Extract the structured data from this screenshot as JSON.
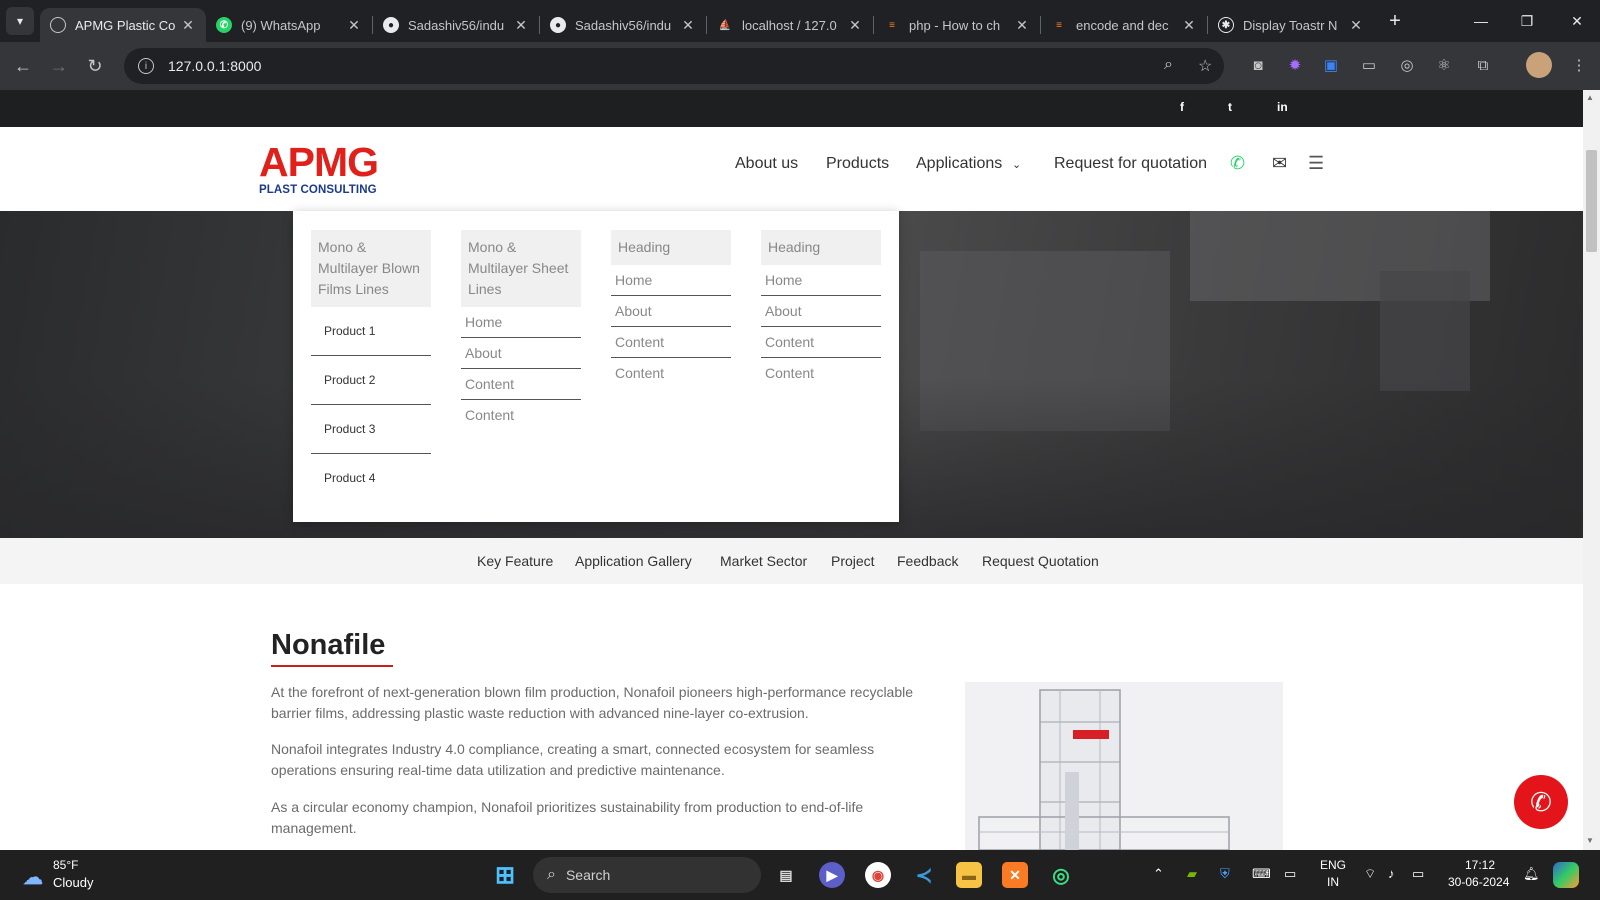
{
  "browser": {
    "tabs": [
      {
        "title": "APMG Plastic Co",
        "active": true,
        "favicon": "globe-icon"
      },
      {
        "title": "(9) WhatsApp",
        "active": false,
        "favicon": "whatsapp-icon"
      },
      {
        "title": "Sadashiv56/indu",
        "active": false,
        "favicon": "github-icon"
      },
      {
        "title": "Sadashiv56/indu",
        "active": false,
        "favicon": "github-icon"
      },
      {
        "title": "localhost / 127.0",
        "active": false,
        "favicon": "phpmyadmin-icon"
      },
      {
        "title": "php - How to ch",
        "active": false,
        "favicon": "stackoverflow-icon"
      },
      {
        "title": "encode and dec",
        "active": false,
        "favicon": "stackoverflow-icon"
      },
      {
        "title": "Display Toastr N",
        "active": false,
        "favicon": "chatgpt-icon"
      }
    ],
    "address": "127.0.0.1:8000"
  },
  "site": {
    "social": [
      "f",
      "t",
      "in"
    ],
    "logo": {
      "main": "APMG",
      "sub": "PLAST CONSULTING"
    },
    "nav": {
      "about": "About us",
      "products": "Products",
      "applications": "Applications",
      "request": "Request for quotation"
    },
    "mega_menu": {
      "col1": {
        "heading": "Mono & Multilayer Blown Films Lines",
        "links": [
          "Product 1",
          "Product 2",
          "Product 3",
          "Product 4"
        ]
      },
      "col2": {
        "heading": "Mono & Multilayer Sheet Lines",
        "links": [
          "Home",
          "About",
          "Content",
          "Content"
        ]
      },
      "col3": {
        "heading": "Heading",
        "links": [
          "Home",
          "About",
          "Content",
          "Content"
        ]
      },
      "col4": {
        "heading": "Heading",
        "links": [
          "Home",
          "About",
          "Content",
          "Content"
        ]
      }
    },
    "subnav": [
      "Key Feature",
      "Application Gallery",
      "Market Sector",
      "Project",
      "Feedback",
      "Request Quotation"
    ],
    "content": {
      "title": "Nonafile",
      "paragraphs": [
        "At the forefront of next-generation blown film production, Nonafoil pioneers high-performance recyclable barrier films, addressing plastic waste reduction with advanced nine-layer co-extrusion.",
        "Nonafoil integrates Industry 4.0 compliance, creating a smart, connected ecosystem for seamless operations ensuring real-time data utilization and predictive maintenance.",
        "As a circular economy champion, Nonafoil prioritizes sustainability from production to end-of-life management."
      ]
    },
    "colors": {
      "brand_red": "#e0201b",
      "brand_blue": "#1a3a8e",
      "whatsapp": "#25d366"
    }
  },
  "taskbar": {
    "weather": {
      "temp": "85°F",
      "condition": "Cloudy"
    },
    "search_placeholder": "Search",
    "language": {
      "line1": "ENG",
      "line2": "IN"
    },
    "clock": {
      "time": "17:12",
      "date": "30-06-2024"
    }
  }
}
